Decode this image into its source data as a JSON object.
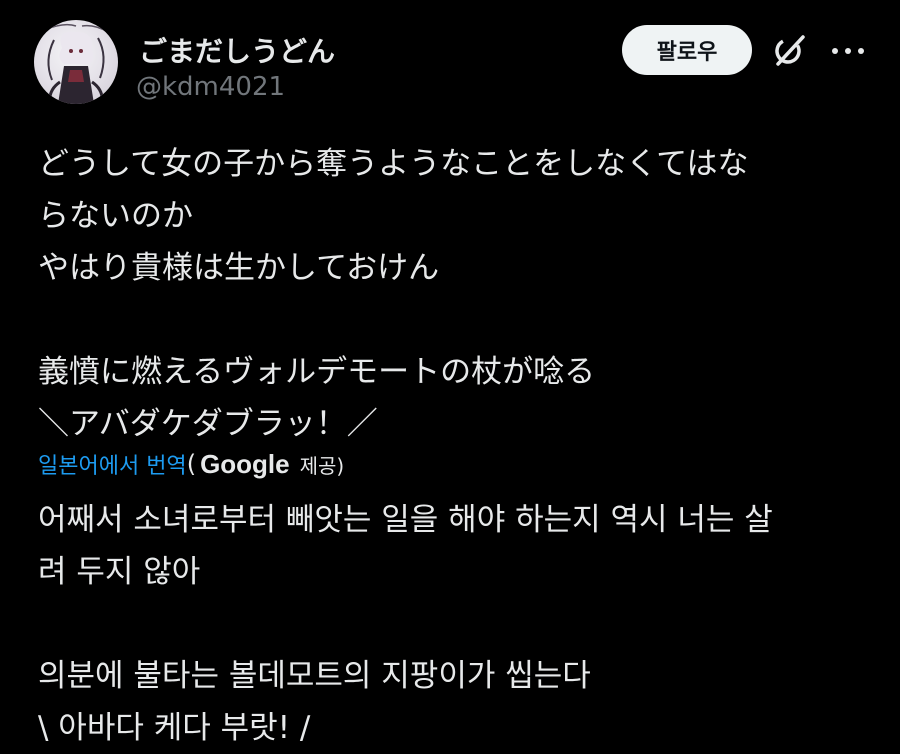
{
  "author": {
    "display_name": "ごまだしうどん",
    "handle": "@kdm4021"
  },
  "actions": {
    "follow_label": "팔로우",
    "grok_icon": "grok-icon",
    "more_icon": "more-icon"
  },
  "tweet": {
    "lines": [
      "どうして女の子から奪うようなことをしなくてはな",
      "らないのか",
      "やはり貴様は生かしておけん",
      "",
      "義憤に燃えるヴォルデモートの杖が唸る",
      "＼アバダケダブラッ！／"
    ]
  },
  "translation": {
    "link_label": "일본어에서 번역",
    "open_paren": "(",
    "provider": "Google",
    "provided_label": "제공)",
    "lines": [
      "어째서 소녀로부터 빼앗는 일을 해야 하는지 역시 너는 살",
      "려 두지 않아",
      "",
      "의분에 불타는 볼데모트의 지팡이가 씹는다",
      "\\ 아바다 케다 부랏! /"
    ]
  },
  "colors": {
    "background": "#000000",
    "text": "#e7e9ea",
    "muted": "#71767b",
    "link": "#1d9bf0",
    "button_bg": "#eff3f4"
  }
}
